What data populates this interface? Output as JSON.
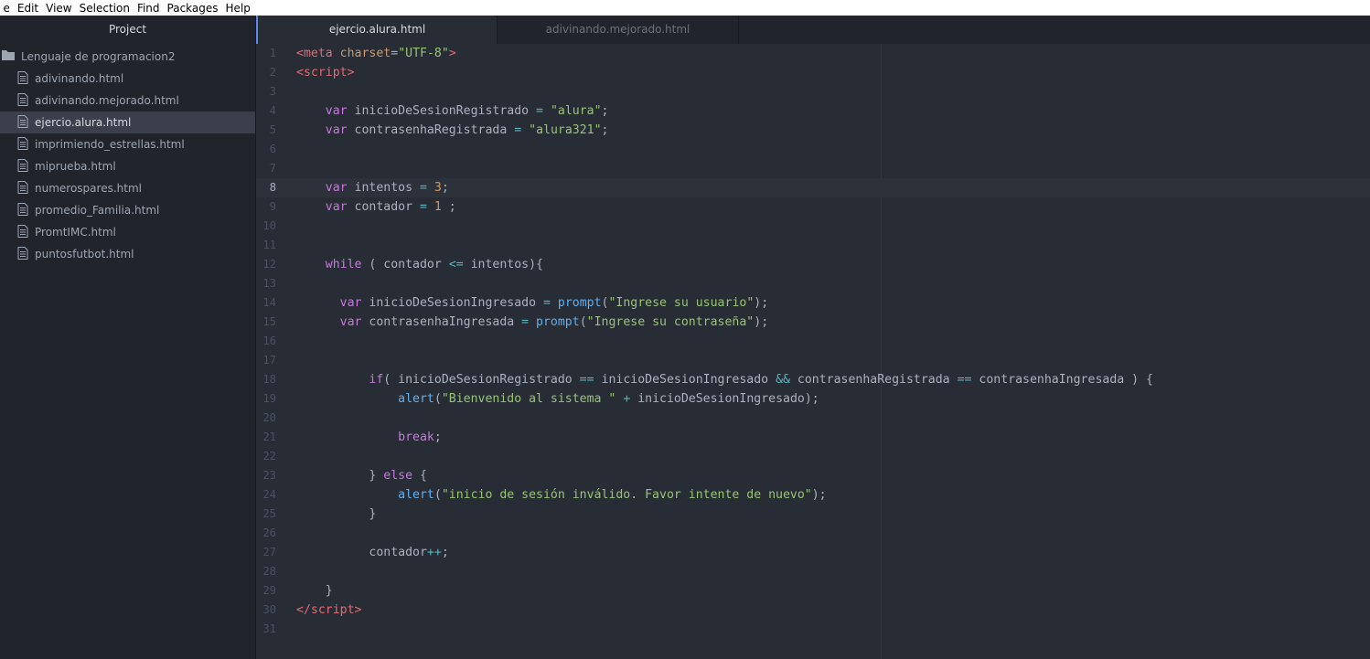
{
  "menu": [
    "e",
    "Edit",
    "View",
    "Selection",
    "Find",
    "Packages",
    "Help"
  ],
  "sidebar": {
    "title": "Project",
    "folder": "Lenguaje de programacion2",
    "files": [
      "adivinando.html",
      "adivinando.mejorado.html",
      "ejercio.alura.html",
      "imprimiendo_estrellas.html",
      "miprueba.html",
      "numerospares.html",
      "promedio_Familia.html",
      "PromtIMC.html",
      "puntosfutbot.html"
    ],
    "selected": "ejercio.alura.html"
  },
  "tabs": [
    {
      "label": "ejercio.alura.html",
      "active": true
    },
    {
      "label": "adivinando.mejorado.html",
      "active": false
    }
  ],
  "editor": {
    "cursor_line": 8,
    "lines": [
      [
        [
          "tag",
          "<meta"
        ],
        [
          "txt",
          " "
        ],
        [
          "attr",
          "charset"
        ],
        [
          "txt",
          "="
        ],
        [
          "str",
          "\"UTF-8\""
        ],
        [
          "tag",
          ">"
        ]
      ],
      [
        [
          "tag",
          "<script>"
        ]
      ],
      [],
      [
        [
          "txt",
          "    "
        ],
        [
          "kw",
          "var"
        ],
        [
          "txt",
          " inicioDeSesionRegistrado "
        ],
        [
          "op",
          "="
        ],
        [
          "txt",
          " "
        ],
        [
          "str",
          "\"alura\""
        ],
        [
          "txt",
          ";"
        ]
      ],
      [
        [
          "txt",
          "    "
        ],
        [
          "kw",
          "var"
        ],
        [
          "txt",
          " contrasenhaRegistrada "
        ],
        [
          "op",
          "="
        ],
        [
          "txt",
          " "
        ],
        [
          "str",
          "\"alura321\""
        ],
        [
          "txt",
          ";"
        ]
      ],
      [],
      [],
      [
        [
          "txt",
          "    "
        ],
        [
          "kw",
          "var"
        ],
        [
          "txt",
          " intentos "
        ],
        [
          "op",
          "="
        ],
        [
          "txt",
          " "
        ],
        [
          "num",
          "3"
        ],
        [
          "txt",
          ";"
        ]
      ],
      [
        [
          "txt",
          "    "
        ],
        [
          "kw",
          "var"
        ],
        [
          "txt",
          " contador "
        ],
        [
          "op",
          "="
        ],
        [
          "txt",
          " "
        ],
        [
          "num",
          "1"
        ],
        [
          "txt",
          " ;"
        ]
      ],
      [],
      [],
      [
        [
          "txt",
          "    "
        ],
        [
          "kw",
          "while"
        ],
        [
          "txt",
          " ( contador "
        ],
        [
          "op",
          "<="
        ],
        [
          "txt",
          " intentos){"
        ]
      ],
      [],
      [
        [
          "txt",
          "      "
        ],
        [
          "kw",
          "var"
        ],
        [
          "txt",
          " inicioDeSesionIngresado "
        ],
        [
          "op",
          "="
        ],
        [
          "txt",
          " "
        ],
        [
          "fn",
          "prompt"
        ],
        [
          "txt",
          "("
        ],
        [
          "str",
          "\"Ingrese su usuario\""
        ],
        [
          "txt",
          ");"
        ]
      ],
      [
        [
          "txt",
          "      "
        ],
        [
          "kw",
          "var"
        ],
        [
          "txt",
          " contrasenhaIngresada "
        ],
        [
          "op",
          "="
        ],
        [
          "txt",
          " "
        ],
        [
          "fn",
          "prompt"
        ],
        [
          "txt",
          "("
        ],
        [
          "str",
          "\"Ingrese su contraseña\""
        ],
        [
          "txt",
          ");"
        ]
      ],
      [],
      [],
      [
        [
          "txt",
          "          "
        ],
        [
          "kw",
          "if"
        ],
        [
          "txt",
          "( inicioDeSesionRegistrado "
        ],
        [
          "op",
          "=="
        ],
        [
          "txt",
          " inicioDeSesionIngresado "
        ],
        [
          "op",
          "&&"
        ],
        [
          "txt",
          " contrasenhaRegistrada "
        ],
        [
          "op",
          "=="
        ],
        [
          "txt",
          " contrasenhaIngresada ) {"
        ]
      ],
      [
        [
          "txt",
          "              "
        ],
        [
          "fn",
          "alert"
        ],
        [
          "txt",
          "("
        ],
        [
          "str",
          "\"Bienvenido al sistema \""
        ],
        [
          "txt",
          " "
        ],
        [
          "op",
          "+"
        ],
        [
          "txt",
          " inicioDeSesionIngresado);"
        ]
      ],
      [],
      [
        [
          "txt",
          "              "
        ],
        [
          "kw",
          "break"
        ],
        [
          "txt",
          ";"
        ]
      ],
      [],
      [
        [
          "txt",
          "          } "
        ],
        [
          "kw",
          "else"
        ],
        [
          "txt",
          " {"
        ]
      ],
      [
        [
          "txt",
          "              "
        ],
        [
          "fn",
          "alert"
        ],
        [
          "txt",
          "("
        ],
        [
          "str",
          "\"inicio de sesión inválido. Favor intente de nuevo\""
        ],
        [
          "txt",
          ");"
        ]
      ],
      [
        [
          "txt",
          "          }"
        ]
      ],
      [],
      [
        [
          "txt",
          "          contador"
        ],
        [
          "op",
          "++"
        ],
        [
          "txt",
          ";"
        ]
      ],
      [],
      [
        [
          "txt",
          "    }"
        ]
      ],
      [
        [
          "tag",
          "</script>"
        ]
      ],
      []
    ]
  },
  "colors": {
    "background": "#282c34",
    "sidebar": "#21252b",
    "accent": "#568af2"
  }
}
